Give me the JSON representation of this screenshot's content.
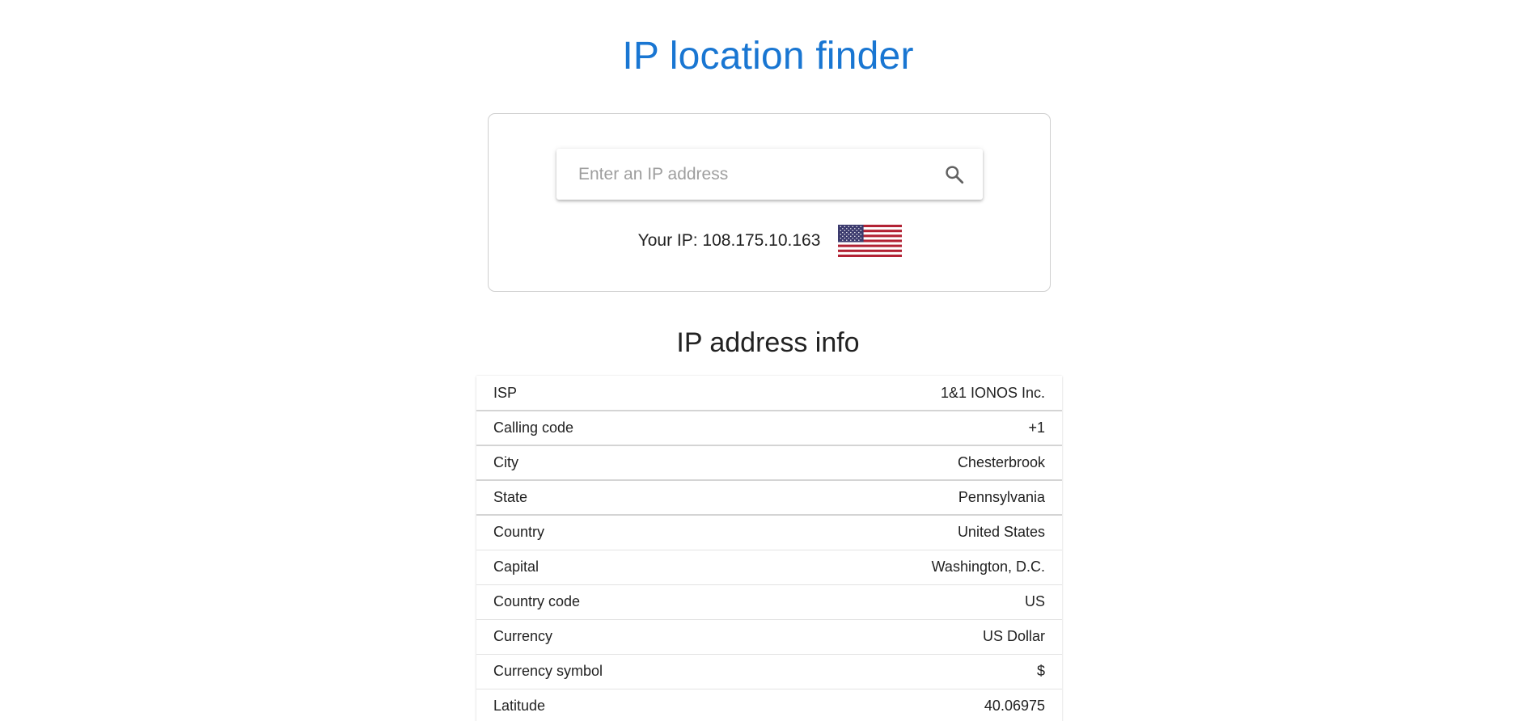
{
  "header": {
    "title": "IP location finder"
  },
  "search": {
    "placeholder": "Enter an IP address",
    "value": "",
    "icon": "search-icon"
  },
  "your_ip": {
    "text": "Your IP: 108.175.10.163",
    "flag_icon": "us-flag-icon"
  },
  "info": {
    "title": "IP address info",
    "rows": [
      {
        "label": "ISP",
        "value": "1&1 IONOS Inc."
      },
      {
        "label": "Calling code",
        "value": "+1"
      },
      {
        "label": "City",
        "value": "Chesterbrook"
      },
      {
        "label": "State",
        "value": "Pennsylvania"
      },
      {
        "label": "Country",
        "value": "United States"
      },
      {
        "label": "Capital",
        "value": "Washington, D.C."
      },
      {
        "label": "Country code",
        "value": "US"
      },
      {
        "label": "Currency",
        "value": "US Dollar"
      },
      {
        "label": "Currency symbol",
        "value": "$"
      },
      {
        "label": "Latitude",
        "value": "40.06975"
      }
    ]
  },
  "colors": {
    "accent": "#1976d2",
    "text": "#222222",
    "placeholder": "#9e9e9e",
    "border": "#cfcfcf",
    "flag_red": "#b22234",
    "flag_blue": "#3c3b6e"
  }
}
